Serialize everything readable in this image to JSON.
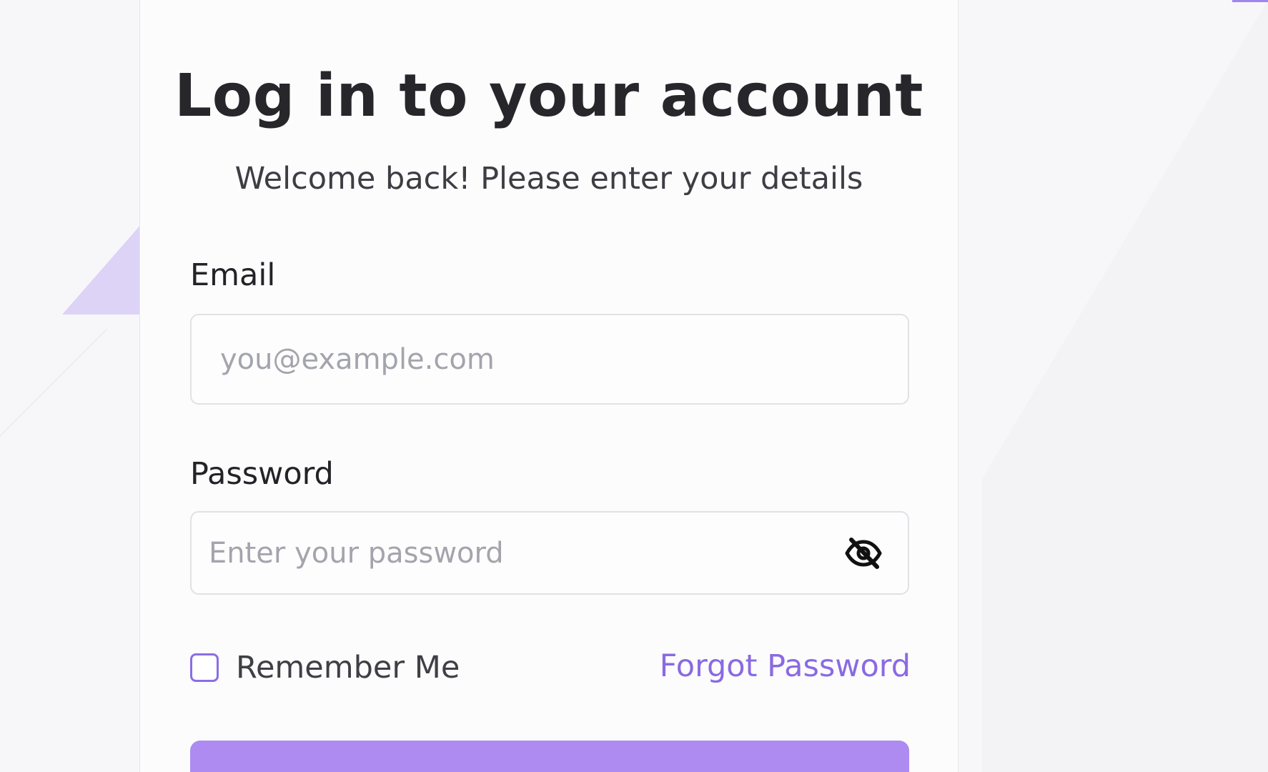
{
  "colors": {
    "background": "#f7f7f9",
    "card": "#fcfcfd",
    "accent": "#ad8bf1",
    "link": "#8a6ae2",
    "text": "#26262b"
  },
  "login": {
    "title": "Log in to your account",
    "subtitle": "Welcome back! Please enter your details",
    "email": {
      "label": "Email",
      "value": "",
      "placeholder": "you@example.com"
    },
    "password": {
      "label": "Password",
      "value": "",
      "placeholder": "Enter your password",
      "toggle_icon": "eye-off-icon"
    },
    "remember_me": {
      "label": "Remember Me",
      "checked": false
    },
    "forgot_password": "Forgot Password",
    "submit_button_visible": true
  }
}
